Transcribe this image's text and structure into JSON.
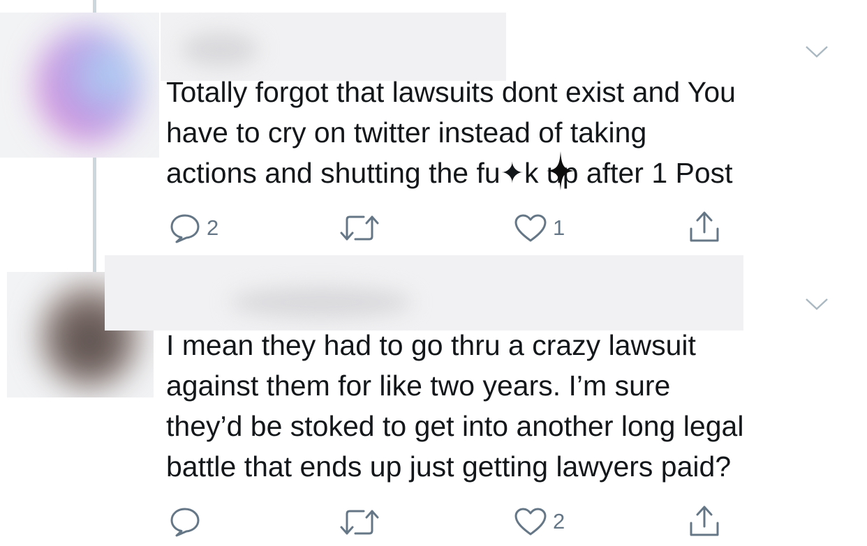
{
  "tweets": [
    {
      "text_lines": [
        "Totally forgot that lawsuits dont exist and You",
        "have to cry on twitter instead of taking",
        "actions and shutting the fu✦k up after 1 Post"
      ],
      "reply_count": "2",
      "retweet_count": "",
      "like_count": "1"
    },
    {
      "text_lines": [
        "I mean they had to go thru a crazy lawsuit",
        "against them for like two years. I’m sure",
        "they’d be stoked to get into another long legal",
        "battle that ends up just getting lawyers paid?"
      ],
      "reply_count": "",
      "retweet_count": "",
      "like_count": "2"
    }
  ],
  "icons": {
    "reply": "reply-icon",
    "retweet": "retweet-icon",
    "like": "heart-icon",
    "share": "share-icon",
    "menu": "chevron-down-icon"
  },
  "colors": {
    "icon": "#657786",
    "text": "#14171a",
    "thread_line": "#ccd6dd"
  }
}
